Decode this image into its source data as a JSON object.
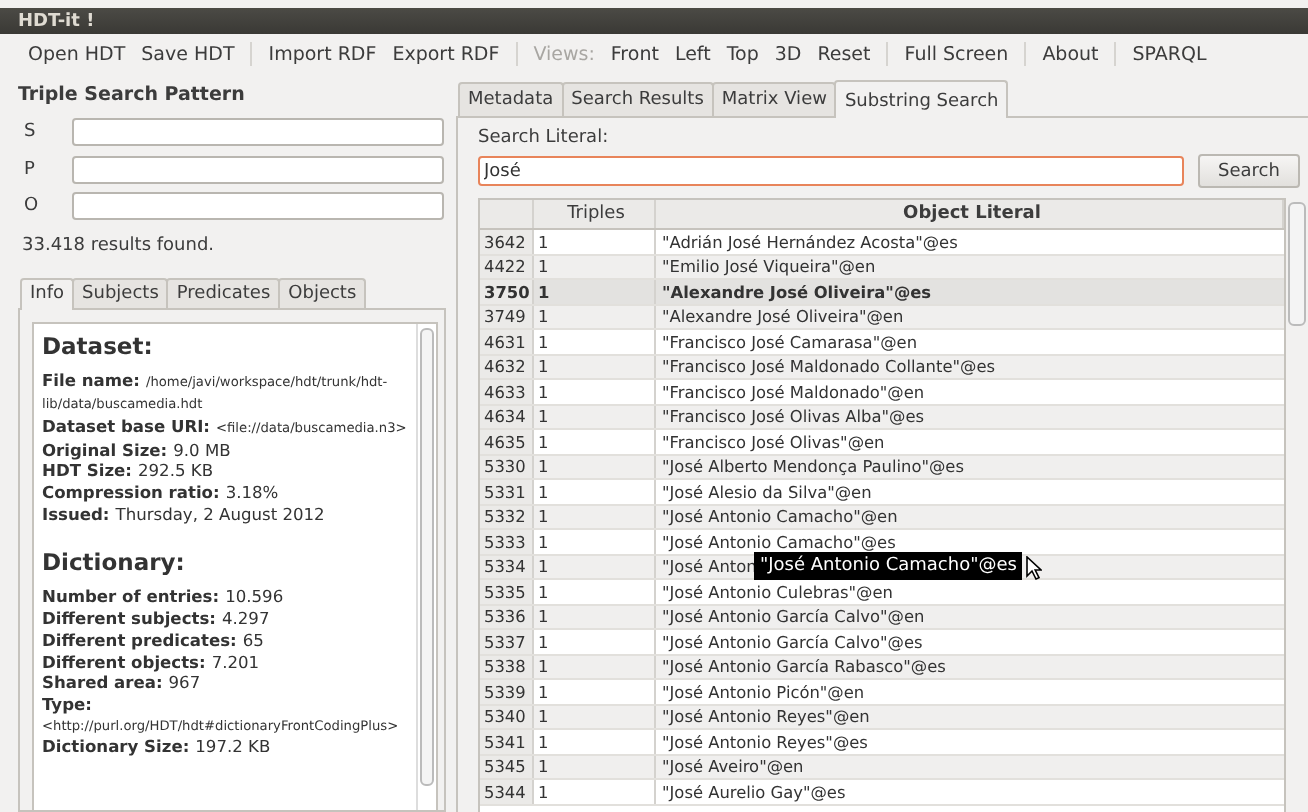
{
  "window": {
    "title": "HDT-it !"
  },
  "toolbar": [
    {
      "kind": "button",
      "label": "Open HDT"
    },
    {
      "kind": "button",
      "label": "Save HDT"
    },
    {
      "kind": "separator"
    },
    {
      "kind": "button",
      "label": "Import RDF"
    },
    {
      "kind": "button",
      "label": "Export RDF"
    },
    {
      "kind": "separator"
    },
    {
      "kind": "label",
      "label": "Views:"
    },
    {
      "kind": "button",
      "label": "Front"
    },
    {
      "kind": "button",
      "label": "Left"
    },
    {
      "kind": "button",
      "label": "Top"
    },
    {
      "kind": "button",
      "label": "3D"
    },
    {
      "kind": "button",
      "label": "Reset"
    },
    {
      "kind": "separator"
    },
    {
      "kind": "button",
      "label": "Full Screen"
    },
    {
      "kind": "separator"
    },
    {
      "kind": "button",
      "label": "About"
    },
    {
      "kind": "separator"
    },
    {
      "kind": "button",
      "label": "SPARQL"
    }
  ],
  "search_pattern": {
    "title": "Triple Search Pattern",
    "fields": [
      {
        "label": "S"
      },
      {
        "label": "P"
      },
      {
        "label": "O"
      }
    ],
    "results": "33.418 results found."
  },
  "info_tabs": [
    {
      "label": "Info",
      "selected": true
    },
    {
      "label": "Subjects",
      "selected": false
    },
    {
      "label": "Predicates",
      "selected": false
    },
    {
      "label": "Objects",
      "selected": false
    }
  ],
  "info": [
    {
      "heading": "Dataset:",
      "lines": [
        {
          "label": "File name:",
          "value": "/home/javi/workspace/hdt/trunk/hdt-lib/data/buscamedia.hdt",
          "kind": "small"
        },
        {
          "label": "Dataset base URI:",
          "value": "<file://data/buscamedia.n3>",
          "kind": "small"
        },
        {
          "label": "Original Size:",
          "value": "9.0 MB",
          "kind": "plain"
        },
        {
          "label": "HDT Size:",
          "value": "292.5 KB",
          "kind": "plain"
        },
        {
          "label": "Compression ratio:",
          "value": "3.18%",
          "kind": "plain"
        },
        {
          "label": "Issued:",
          "value": "Thursday, 2 August 2012",
          "kind": "plain"
        }
      ]
    },
    {
      "heading": "Dictionary:",
      "lines": [
        {
          "label": "Number of entries:",
          "value": "10.596",
          "kind": "plain"
        },
        {
          "label": "Different subjects:",
          "value": "4.297",
          "kind": "plain"
        },
        {
          "label": "Different predicates:",
          "value": "65",
          "kind": "plain"
        },
        {
          "label": "Different objects:",
          "value": "7.201",
          "kind": "plain"
        },
        {
          "label": "Shared area:",
          "value": "967",
          "kind": "plain"
        },
        {
          "label": "Type:",
          "value": "<http://purl.org/HDT/hdt#dictionaryFrontCodingPlus>",
          "kind": "small_below"
        },
        {
          "label": "Dictionary Size:",
          "value": "197.2 KB",
          "kind": "plain"
        }
      ]
    }
  ],
  "main_tabs": [
    {
      "label": "Metadata",
      "selected": false
    },
    {
      "label": "Search Results",
      "selected": false
    },
    {
      "label": "Matrix View",
      "selected": false
    },
    {
      "label": "Substring Search",
      "selected": true
    }
  ],
  "substring_search": {
    "label": "Search Literal:",
    "value": "José",
    "button": "Search"
  },
  "table": {
    "columns": [
      "Triples",
      "Object Literal"
    ],
    "rows": [
      {
        "id": "3642",
        "triples": "1",
        "literal": "\"Adrián José Hernández Acosta\"@es",
        "selected": false
      },
      {
        "id": "4422",
        "triples": "1",
        "literal": "\"Emilio José Viqueira\"@en",
        "selected": false
      },
      {
        "id": "3750",
        "triples": "1",
        "literal": "\"Alexandre José Oliveira\"@es",
        "selected": true
      },
      {
        "id": "3749",
        "triples": "1",
        "literal": "\"Alexandre José Oliveira\"@en",
        "selected": false
      },
      {
        "id": "4631",
        "triples": "1",
        "literal": "\"Francisco José Camarasa\"@en",
        "selected": false
      },
      {
        "id": "4632",
        "triples": "1",
        "literal": "\"Francisco José Maldonado Collante\"@es",
        "selected": false
      },
      {
        "id": "4633",
        "triples": "1",
        "literal": "\"Francisco José Maldonado\"@en",
        "selected": false
      },
      {
        "id": "4634",
        "triples": "1",
        "literal": "\"Francisco José Olivas Alba\"@es",
        "selected": false
      },
      {
        "id": "4635",
        "triples": "1",
        "literal": "\"Francisco José Olivas\"@en",
        "selected": false
      },
      {
        "id": "5330",
        "triples": "1",
        "literal": "\"José Alberto Mendonça Paulino\"@es",
        "selected": false
      },
      {
        "id": "5331",
        "triples": "1",
        "literal": "\"José Alesio da Silva\"@en",
        "selected": false
      },
      {
        "id": "5332",
        "triples": "1",
        "literal": "\"José Antonio Camacho\"@en",
        "selected": false
      },
      {
        "id": "5333",
        "triples": "1",
        "literal": "\"José Antonio Camacho\"@es",
        "selected": false
      },
      {
        "id": "5334",
        "triples": "1",
        "literal": "\"José Anton",
        "selected": false
      },
      {
        "id": "5335",
        "triples": "1",
        "literal": "\"José Antonio Culebras\"@en",
        "selected": false
      },
      {
        "id": "5336",
        "triples": "1",
        "literal": "\"José Antonio García Calvo\"@en",
        "selected": false
      },
      {
        "id": "5337",
        "triples": "1",
        "literal": "\"José Antonio García Calvo\"@es",
        "selected": false
      },
      {
        "id": "5338",
        "triples": "1",
        "literal": "\"José Antonio García Rabasco\"@es",
        "selected": false
      },
      {
        "id": "5339",
        "triples": "1",
        "literal": "\"José Antonio Picón\"@en",
        "selected": false
      },
      {
        "id": "5340",
        "triples": "1",
        "literal": "\"José Antonio Reyes\"@en",
        "selected": false
      },
      {
        "id": "5341",
        "triples": "1",
        "literal": "\"José Antonio Reyes\"@es",
        "selected": false
      },
      {
        "id": "5345",
        "triples": "1",
        "literal": "\"José Aveiro\"@en",
        "selected": false
      },
      {
        "id": "5344",
        "triples": "1",
        "literal": "\"José Aurelio Gay\"@es",
        "selected": false
      }
    ]
  },
  "tooltip": "\"José Antonio Camacho\"@es"
}
